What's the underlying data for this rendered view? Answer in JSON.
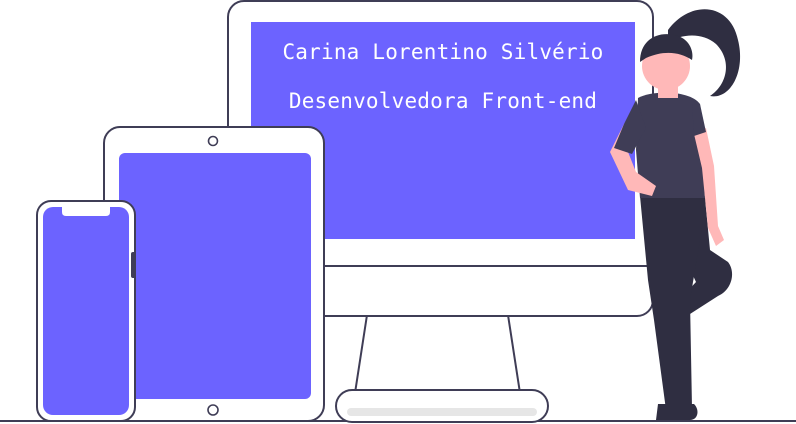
{
  "hero": {
    "name": "Carina Lorentino Silvério",
    "role": "Desenvolvedora Front-end"
  },
  "illustration": {
    "name": "devices-with-woman-illustration",
    "accent_color": "#6c63ff",
    "outline_color": "#3f3d56",
    "skin_color": "#ffb8b8",
    "hair_color": "#2f2e41"
  }
}
